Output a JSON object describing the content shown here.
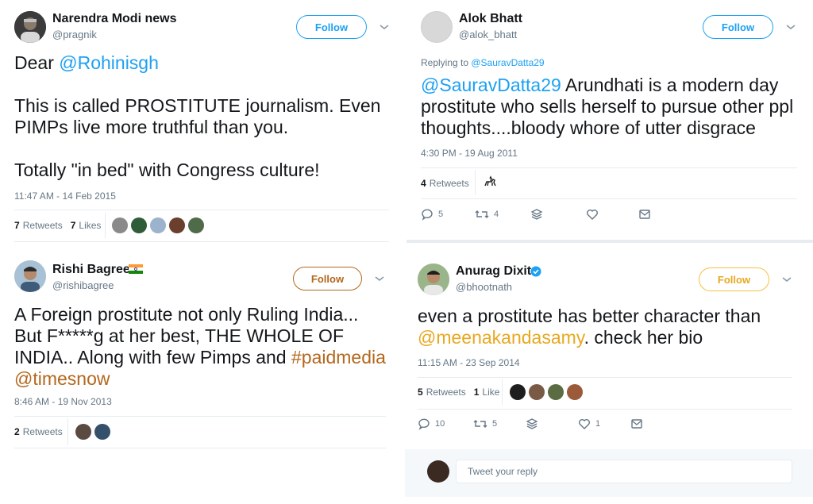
{
  "tweets": [
    {
      "name": "Narendra Modi news",
      "handle": "@pragnik",
      "follow_label": "Follow",
      "text_prefix": "Dear ",
      "mention": "@Rohinisgh",
      "body1": "This is called PROSTITUTE journalism. Even PIMPs live more truthful than you.",
      "body2": "Totally \"in bed\" with Congress culture!",
      "timestamp": "11:47 AM - 14 Feb 2015",
      "retweets_count": "7",
      "retweets_label": "Retweets",
      "likes_count": "7",
      "likes_label": "Likes"
    },
    {
      "name": "Alok Bhatt",
      "handle": "@alok_bhatt",
      "follow_label": "Follow",
      "replying_prefix": "Replying to ",
      "replying_to": "@SauravDatta29",
      "mention": "@SauravDatta29",
      "text": " Arundhati is a modern day prostitute who sells herself to pursue other ppl thoughts....bloody whore of utter disgrace",
      "timestamp": "4:30 PM - 19 Aug 2011",
      "retweets_count": "4",
      "retweets_label": "Retweets",
      "replies": "5",
      "rts": "4"
    },
    {
      "name": "Rishi Bagree",
      "handle": "@rishibagree",
      "follow_label": "Follow",
      "text": "A Foreign prostitute not only Ruling India... But F*****g  at her best, THE WHOLE OF INDIA.. Along with few Pimps and ",
      "hashtag": "#paidmedia",
      "mention": " @timesnow",
      "timestamp": "8:46 AM - 19 Nov 2013",
      "retweets_count": "2",
      "retweets_label": "Retweets"
    },
    {
      "name": "Anurag Dixit",
      "handle": "@bhootnath",
      "follow_label": "Follow",
      "text1": "even a prostitute has better character than ",
      "mention": "@meenakandasamy",
      "text2": ". check her bio",
      "timestamp": "11:15 AM - 23 Sep 2014",
      "retweets_count": "5",
      "retweets_label": "Retweets",
      "likes_count": "1",
      "likes_label": "Like",
      "replies": "10",
      "rts": "5",
      "likes": "1",
      "reply_placeholder": "Tweet your reply"
    }
  ],
  "icons": [
    "reply-icon",
    "retweet-icon",
    "stack-icon",
    "heart-icon",
    "message-icon",
    "chevron-down-icon",
    "verified-icon",
    "india-flag-icon",
    "horse-rider-icon"
  ],
  "colors": {
    "link_blue": "#1da1f2",
    "link_brown": "#b3671c",
    "link_gold": "#e8a821",
    "muted": "#657786"
  }
}
